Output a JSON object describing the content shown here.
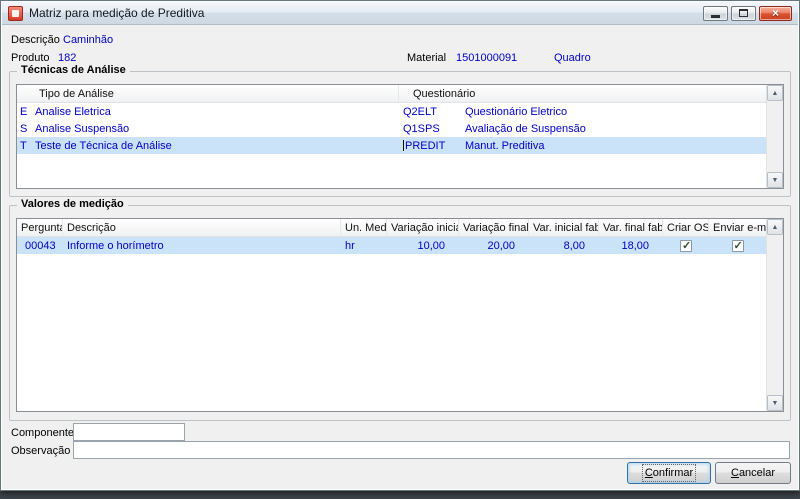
{
  "window": {
    "title": "Matriz para medição de Preditiva"
  },
  "icons": {
    "close": "×",
    "scroll_up": "▲",
    "scroll_down": "▼",
    "check": "✓"
  },
  "colors": {
    "value_text": "#0000c8",
    "selection_bg": "#cbe3f8",
    "close_button_red": "#d9542f",
    "dialog_bg": "#f0f0f0"
  },
  "fields": {
    "descricao_label": "Descrição",
    "descricao_value": "Caminhão",
    "produto_label": "Produto",
    "produto_value": "182",
    "material_label": "Material",
    "material_value": "1501000091",
    "material_desc": "Quadro"
  },
  "tecnicas": {
    "title": "Técnicas de Análise",
    "columns": [
      "Tipo de Análise",
      "Questionário"
    ],
    "rows": [
      {
        "tipo": "E",
        "analise": "Analise Eletrica",
        "quest_code": "Q2ELT",
        "quest_desc": "Questionário Eletrico",
        "selected": false
      },
      {
        "tipo": "S",
        "analise": "Analise Suspensão",
        "quest_code": "Q1SPS",
        "quest_desc": "Avaliação de Suspensão",
        "selected": false
      },
      {
        "tipo": "T",
        "analise": "Teste de Técnica de Análise",
        "quest_code": "PREDIT",
        "quest_desc": "Manut. Preditiva",
        "selected": true
      }
    ]
  },
  "valores": {
    "title": "Valores de medição",
    "columns": [
      "Pergunta",
      "Descrição",
      "Un. Med.",
      "Variação inicial",
      "Variação final",
      "Var. inicial fab.",
      "Var. final fab.",
      "Criar OS",
      "Enviar e-mail"
    ],
    "rows": [
      {
        "pergunta": "00043",
        "descricao": "Informe o horímetro",
        "un_med": "hr",
        "variacao_inicial": "10,00",
        "variacao_final": "20,00",
        "var_inicial_fab": "8,00",
        "var_final_fab": "18,00",
        "criar_os": true,
        "enviar_email": true,
        "selected": true
      }
    ]
  },
  "footer": {
    "componente_label": "Componente",
    "componente_value": "",
    "observacao_label": "Observação",
    "observacao_value": "",
    "confirm_label": "Confirmar",
    "cancel_label": "Cancelar"
  }
}
